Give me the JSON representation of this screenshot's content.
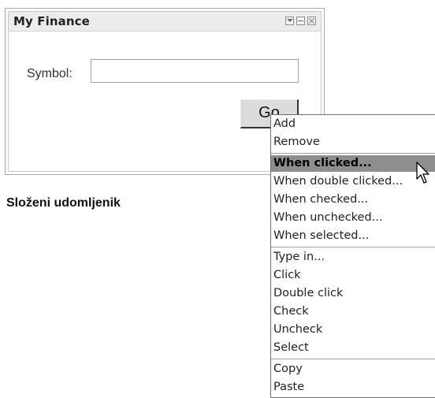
{
  "widget": {
    "title": "My Finance",
    "icons": [
      "dropdown-icon",
      "minimize-icon",
      "close-icon"
    ],
    "symbol_label": "Symbol:",
    "symbol_value": "",
    "go_label": "Go"
  },
  "caption": "Složeni udomljenik",
  "context_menu": {
    "groups": [
      [
        "Add",
        "Remove"
      ],
      [
        "When clicked...",
        "When double clicked...",
        "When checked...",
        "When unchecked...",
        "When selected..."
      ],
      [
        "Type in...",
        "Click",
        "Double click",
        "Check",
        "Uncheck",
        "Select"
      ],
      [
        "Copy",
        "Paste"
      ]
    ],
    "highlighted": "When clicked..."
  },
  "colors": {
    "highlight": "#8e8e8e",
    "titlebar": "#ececec"
  }
}
